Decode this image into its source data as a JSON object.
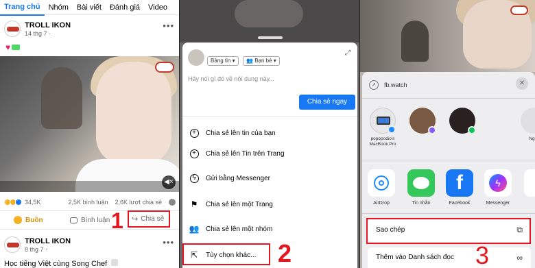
{
  "panel1": {
    "tabs": [
      "Trang chủ",
      "Nhóm",
      "Bài viết",
      "Đánh giá",
      "Video"
    ],
    "post": {
      "author": "TROLL iKON",
      "date": "14 thg 7 ·",
      "reaction_count": "34,5K",
      "comments": "2,5K bình luận",
      "shares": "2,6K lượt chia sẻ"
    },
    "actions": {
      "react": "Buồn",
      "comment": "Bình luận",
      "share": "Chia sẻ"
    },
    "post2": {
      "author": "TROLL iKON",
      "date": "8 thg 7 ·",
      "text": "Học tiếng Việt cùng Song Chef"
    }
  },
  "panel2": {
    "audience_chip": "Bảng tin",
    "friends_chip": "Bạn bè",
    "compose_placeholder": "Hãy nói gì đó về nội dung này...",
    "share_now": "Chia sẻ ngay",
    "menu": [
      "Chia sẻ lên tin của bạn",
      "Chia sẻ lên Tin trên Trang",
      "Gửi bằng Messenger",
      "Chia sẻ lên một Trang",
      "Chia sẻ lên một nhóm",
      "Tùy chọn khác..."
    ]
  },
  "panel3": {
    "url": "fb.watch",
    "people": [
      {
        "name": "popopodio's\nMacBook Pro"
      },
      {
        "name": ""
      },
      {
        "name": ""
      },
      {
        "name": "Nghi"
      }
    ],
    "apps": [
      "AirDrop",
      "Tin nhắn",
      "Facebook",
      "Messenger"
    ],
    "actions": [
      "Sao chép",
      "Thêm vào Danh sách đọc"
    ]
  },
  "steps": [
    "1",
    "2",
    "3"
  ],
  "colors": {
    "facebook_blue": "#1877f2",
    "highlight_red": "#e4161f",
    "react_sad_color": "#d4900c"
  }
}
